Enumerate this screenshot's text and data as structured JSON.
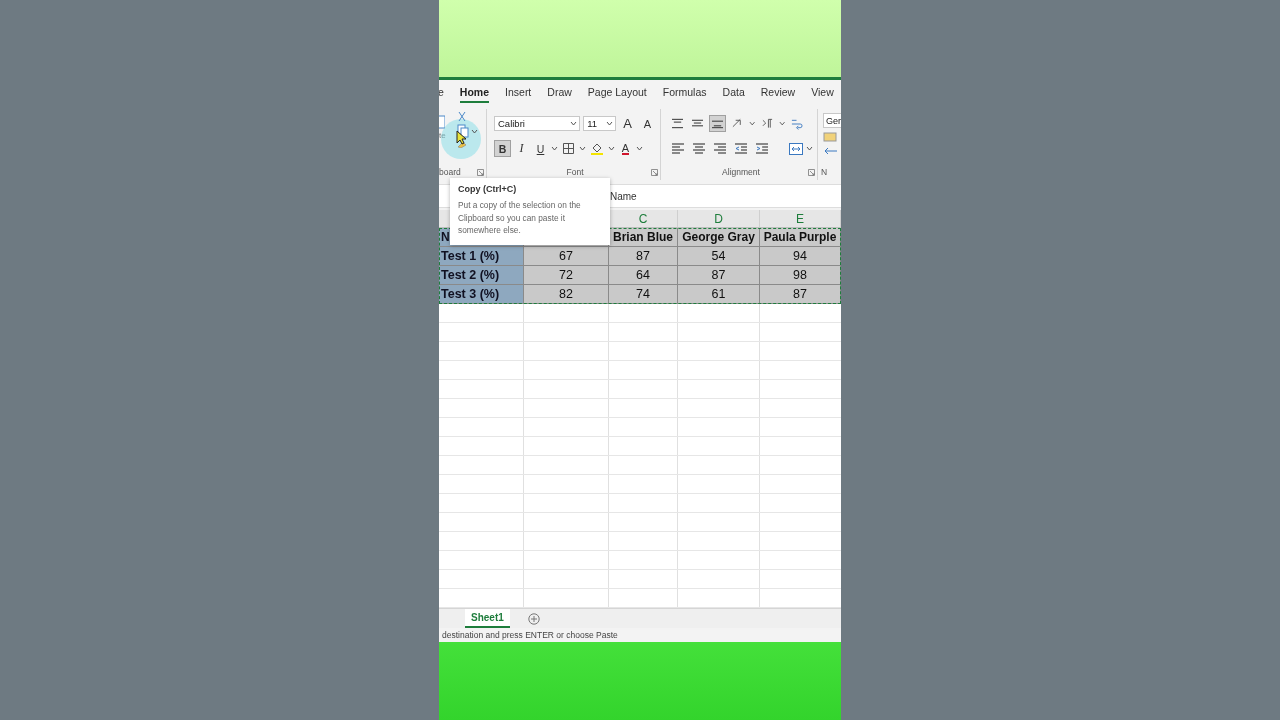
{
  "ribbon_tabs": [
    {
      "label": "e",
      "selected": false
    },
    {
      "label": "Home",
      "selected": true
    },
    {
      "label": "Insert",
      "selected": false
    },
    {
      "label": "Draw",
      "selected": false
    },
    {
      "label": "Page Layout",
      "selected": false
    },
    {
      "label": "Formulas",
      "selected": false
    },
    {
      "label": "Data",
      "selected": false
    },
    {
      "label": "Review",
      "selected": false
    },
    {
      "label": "View",
      "selected": false
    }
  ],
  "clipboard": {
    "paste_label": "te",
    "group_label": "board",
    "copy_highlighted": true
  },
  "font": {
    "name": "Calibri",
    "size": "11",
    "grow": "A",
    "shrink": "A",
    "group_label": "Font",
    "buttons": [
      {
        "kind": "bold",
        "label": "B",
        "pressed": true
      },
      {
        "kind": "italic",
        "label": "I",
        "pressed": false
      },
      {
        "kind": "underline",
        "label": "U",
        "pressed": false
      },
      {
        "kind": "borders",
        "pressed": false
      },
      {
        "kind": "fill",
        "pressed": false
      },
      {
        "kind": "color",
        "label": "A",
        "pressed": false
      }
    ]
  },
  "alignment": {
    "group_label": "Alignment",
    "buttons": [
      {
        "kind": "top",
        "pressed": false
      },
      {
        "kind": "middle",
        "pressed": false
      },
      {
        "kind": "bottom",
        "pressed": true
      },
      {
        "kind": "orientation",
        "pressed": false
      },
      {
        "kind": "direction",
        "pressed": false
      },
      {
        "kind": "left",
        "pressed": false
      },
      {
        "kind": "center",
        "pressed": false
      },
      {
        "kind": "right",
        "pressed": false
      },
      {
        "kind": "outdent",
        "pressed": false
      },
      {
        "kind": "indent",
        "pressed": false
      }
    ]
  },
  "number": {
    "format": "Ger",
    "group_label": "N"
  },
  "tooltip": {
    "title": "Copy (Ctrl+C)",
    "body": "Put a copy of the selection on the Clipboard so you can paste it somewhere else."
  },
  "formula_bar": {
    "value": "Name"
  },
  "column_headers": [
    "C",
    "D",
    "E"
  ],
  "rows": [
    {
      "cells": [
        "N",
        "Brian Blue",
        "George Gray",
        "Paula Purple"
      ]
    },
    {
      "cells": [
        "Test 1 (%)",
        "67",
        "87",
        "54",
        "94"
      ]
    },
    {
      "cells": [
        "Test 2 (%)",
        "72",
        "64",
        "87",
        "98"
      ]
    },
    {
      "cells": [
        "Test 3 (%)",
        "82",
        "74",
        "61",
        "87"
      ]
    }
  ],
  "copy_marquee": true,
  "sheet_tabs": [
    {
      "label": "Sheet1",
      "selected": true
    }
  ],
  "status_bar": "destination and press ENTER or choose Paste"
}
